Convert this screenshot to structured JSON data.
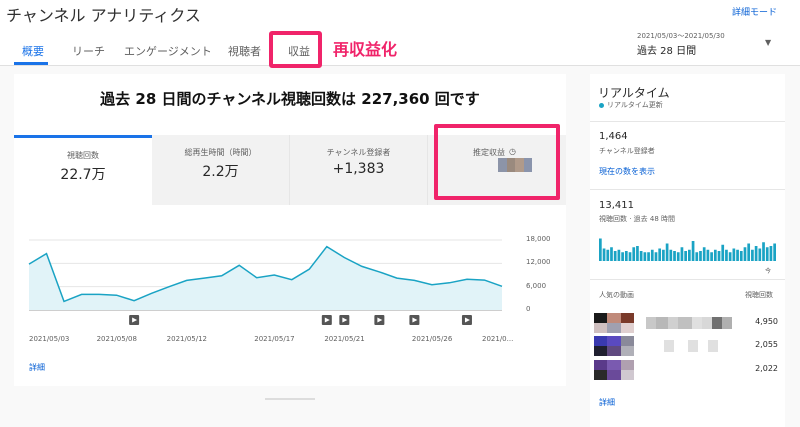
{
  "header": {
    "app_title": "チャンネル アナリティクス",
    "advanced_mode": "詳細モード",
    "tabs": [
      {
        "label": "概要",
        "active": true
      },
      {
        "label": "リーチ"
      },
      {
        "label": "エンゲージメント"
      },
      {
        "label": "視聴者"
      },
      {
        "label": "収益"
      }
    ],
    "annotation": "再収益化",
    "date_range": "2021/05/03～2021/05/30",
    "period": "過去 28 日間"
  },
  "main": {
    "headline": "過去 28 日間のチャンネル視聴回数は 227,360 回です",
    "metrics": [
      {
        "label": "視聴回数",
        "value": "22.7万"
      },
      {
        "label": "総再生時間（時間）",
        "value": "2.2万"
      },
      {
        "label": "チャンネル登録者",
        "value": "+1,383"
      },
      {
        "label": "推定収益",
        "value": ""
      }
    ],
    "details_link": "詳細"
  },
  "chart_data": {
    "type": "area",
    "x": [
      "2021/05/03",
      "2021/05/04",
      "2021/05/05",
      "2021/05/06",
      "2021/05/07",
      "2021/05/08",
      "2021/05/09",
      "2021/05/10",
      "2021/05/11",
      "2021/05/12",
      "2021/05/13",
      "2021/05/14",
      "2021/05/15",
      "2021/05/16",
      "2021/05/17",
      "2021/05/18",
      "2021/05/19",
      "2021/05/20",
      "2021/05/21",
      "2021/05/22",
      "2021/05/23",
      "2021/05/24",
      "2021/05/25",
      "2021/05/26",
      "2021/05/27",
      "2021/05/28",
      "2021/05/29",
      "2021/05/30"
    ],
    "series": [
      {
        "values": [
          11800,
          14500,
          2200,
          4000,
          4000,
          3800,
          2400,
          4300,
          6000,
          7600,
          8200,
          8800,
          11500,
          8300,
          9000,
          7800,
          10500,
          16300,
          13500,
          11200,
          9800,
          8200,
          7600,
          6500,
          7000,
          7900,
          7700,
          6100
        ]
      }
    ],
    "ylim": [
      0,
      18000
    ],
    "yticks": [
      "18,000",
      "12,000",
      "6,000",
      "0"
    ],
    "xticks": [
      "2021/05/03",
      "2021/05/08",
      "2021/05/12",
      "2021/05/17",
      "2021/05/21",
      "2021/05/26",
      "2021/0..."
    ],
    "marker_days": [
      6,
      17,
      18,
      20,
      22,
      25
    ],
    "colors": {
      "line": "#1aa3c4",
      "fill": "#e1f3f8"
    }
  },
  "realtime": {
    "title": "リアルタイム",
    "subtitle": "リアルタイム更新",
    "subscribers": "1,464",
    "subscribers_label": "チャンネル登録者",
    "show_now": "現在の数を表示",
    "views": "13,411",
    "views_label": "視聴回数 · 過去 48 時間",
    "hourly_views": [
      0.9,
      0.5,
      0.45,
      0.55,
      0.4,
      0.45,
      0.35,
      0.4,
      0.35,
      0.55,
      0.6,
      0.4,
      0.35,
      0.35,
      0.45,
      0.35,
      0.5,
      0.45,
      0.7,
      0.45,
      0.4,
      0.35,
      0.55,
      0.4,
      0.45,
      0.8,
      0.35,
      0.4,
      0.55,
      0.45,
      0.35,
      0.45,
      0.4,
      0.65,
      0.45,
      0.35,
      0.5,
      0.45,
      0.4,
      0.55,
      0.7,
      0.45,
      0.6,
      0.5,
      0.75,
      0.55,
      0.6,
      0.7
    ],
    "now_label": "今",
    "popular_header": "人気の動画",
    "views_header": "視聴回数",
    "videos": [
      {
        "count": "4,950"
      },
      {
        "count": "2,055"
      },
      {
        "count": "2,022"
      }
    ],
    "details_link": "詳細"
  }
}
